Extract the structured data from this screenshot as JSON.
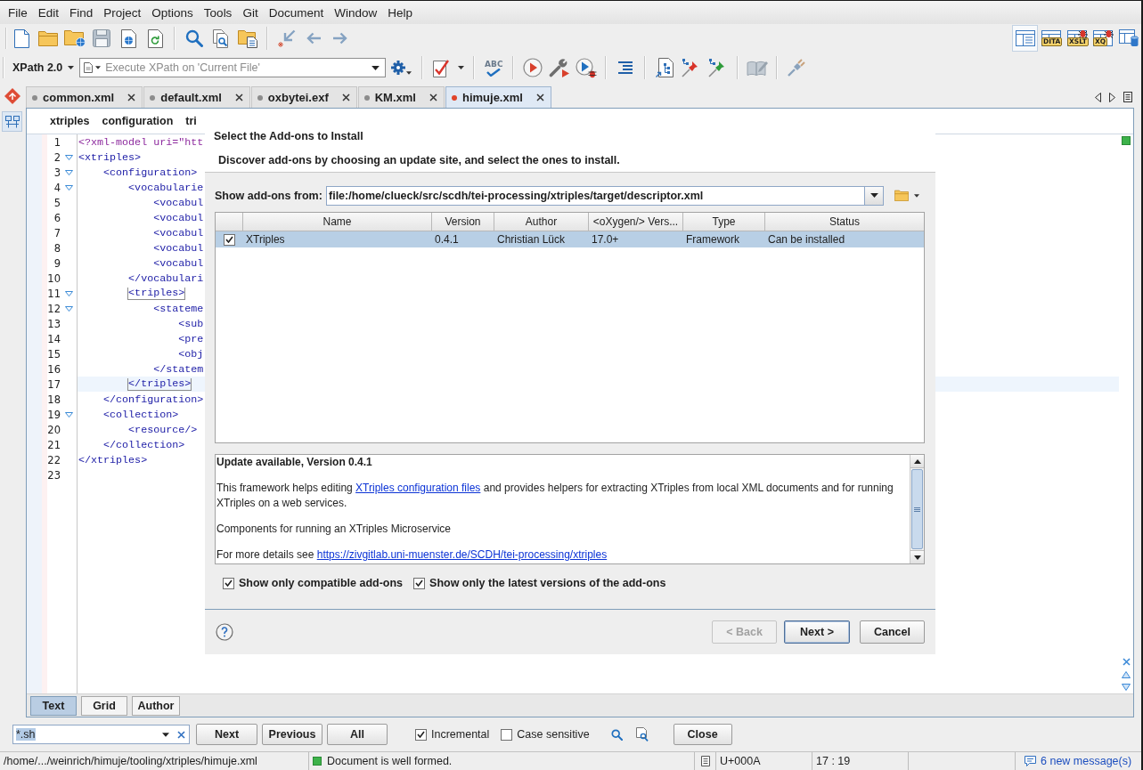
{
  "menu": [
    "File",
    "Edit",
    "Find",
    "Project",
    "Options",
    "Tools",
    "Git",
    "Document",
    "Window",
    "Help"
  ],
  "perspectives": [
    {
      "kind": "editor",
      "selected": true
    },
    {
      "kind": "dita",
      "label": "DITA",
      "selected": false
    },
    {
      "kind": "xslt",
      "label": "XSLT",
      "selected": false
    },
    {
      "kind": "xquery",
      "label": "XQ",
      "selected": false
    },
    {
      "kind": "database",
      "selected": false
    }
  ],
  "toolbar": {
    "xpath_version": "XPath 2.0",
    "xpath_placeholder": "Execute XPath on 'Current File'",
    "spellcheck_label": "ABC"
  },
  "side_views": [
    {
      "kind": "git",
      "selected": false
    },
    {
      "kind": "outline",
      "selected": true
    }
  ],
  "tabs": [
    {
      "label": "common.xml",
      "modified": false,
      "selected": false
    },
    {
      "label": "default.xml",
      "modified": false,
      "selected": false
    },
    {
      "label": "oxbytei.exf",
      "modified": false,
      "selected": false
    },
    {
      "label": "KM.xml",
      "modified": false,
      "selected": false
    },
    {
      "label": "himuje.xml",
      "modified": true,
      "selected": true
    }
  ],
  "breadcrumb": [
    "xtriples",
    "configuration",
    "tri"
  ],
  "editor": {
    "lines": [
      {
        "number": "1",
        "text": "<?xml-model uri=\"htt",
        "kind": "instruction",
        "foldable": false,
        "current": false,
        "matched": false
      },
      {
        "number": "2",
        "text": "<xtriples>",
        "kind": "markup",
        "foldable": true,
        "current": false,
        "matched": false
      },
      {
        "number": "3",
        "text": "    <configuration>",
        "kind": "markup",
        "foldable": true,
        "current": false,
        "matched": false
      },
      {
        "number": "4",
        "text": "        <vocabularie",
        "kind": "markup",
        "foldable": true,
        "current": false,
        "matched": false
      },
      {
        "number": "5",
        "text": "            <vocabul",
        "kind": "markup",
        "foldable": false,
        "current": false,
        "matched": false
      },
      {
        "number": "6",
        "text": "            <vocabul",
        "kind": "markup",
        "foldable": false,
        "current": false,
        "matched": false
      },
      {
        "number": "7",
        "text": "            <vocabul",
        "kind": "markup",
        "foldable": false,
        "current": false,
        "matched": false
      },
      {
        "number": "8",
        "text": "            <vocabul",
        "kind": "markup",
        "foldable": false,
        "current": false,
        "matched": false
      },
      {
        "number": "9",
        "text": "            <vocabul",
        "kind": "markup",
        "foldable": false,
        "current": false,
        "matched": false
      },
      {
        "number": "10",
        "text": "        </vocabulari",
        "kind": "markup",
        "foldable": false,
        "current": false,
        "matched": false
      },
      {
        "number": "11",
        "text": "        <triples>",
        "kind": "markup",
        "foldable": true,
        "current": false,
        "matched": true
      },
      {
        "number": "12",
        "text": "            <stateme",
        "kind": "markup",
        "foldable": true,
        "current": false,
        "matched": false
      },
      {
        "number": "13",
        "text": "                <sub",
        "kind": "markup",
        "foldable": false,
        "current": false,
        "matched": false
      },
      {
        "number": "14",
        "text": "                <pre",
        "kind": "markup",
        "foldable": false,
        "current": false,
        "matched": false
      },
      {
        "number": "15",
        "text": "                <obj",
        "kind": "markup",
        "foldable": false,
        "current": false,
        "matched": false
      },
      {
        "number": "16",
        "text": "            </statem",
        "kind": "markup",
        "foldable": false,
        "current": false,
        "matched": false
      },
      {
        "number": "17",
        "text": "        </triples>",
        "kind": "markup",
        "foldable": false,
        "current": true,
        "matched": true
      },
      {
        "number": "18",
        "text": "    </configuration>",
        "kind": "markup",
        "foldable": false,
        "current": false,
        "matched": false
      },
      {
        "number": "19",
        "text": "    <collection>",
        "kind": "markup",
        "foldable": true,
        "current": false,
        "matched": false
      },
      {
        "number": "20",
        "text": "        <resource/>",
        "kind": "markup",
        "foldable": false,
        "current": false,
        "matched": false
      },
      {
        "number": "21",
        "text": "    </collection>",
        "kind": "markup",
        "foldable": false,
        "current": false,
        "matched": false
      },
      {
        "number": "22",
        "text": "</xtriples>",
        "kind": "markup",
        "foldable": false,
        "current": false,
        "matched": false
      },
      {
        "number": "23",
        "foldable": false,
        "current": false
      }
    ]
  },
  "editor_modes": [
    {
      "label": "Text",
      "selected": true
    },
    {
      "label": "Grid",
      "selected": false
    },
    {
      "label": "Author",
      "selected": false
    }
  ],
  "find_bar": {
    "value": "*.sh",
    "value_selected": true,
    "buttons": [
      "Next",
      "Previous",
      "All"
    ],
    "options": [
      {
        "label": "Incremental",
        "checked": true
      },
      {
        "label": "Case sensitive",
        "checked": false
      }
    ],
    "close": "Close"
  },
  "status_bar": {
    "path": "/home/.../weinrich/himuje/tooling/xtriples/himuje.xml",
    "well_formed": true,
    "message": "Document is well formed.",
    "character": "U+000A",
    "position": "17 : 19",
    "messages": "6 new message(s)"
  },
  "dialog": {
    "title": "Select the Add-ons to Install",
    "subtitle": "Discover add-ons by choosing an update site, and select the ones to install.",
    "source_label": "Show add-ons from:",
    "source": "file:/home/clueck/src/scdh/tei-processing/xtriples/target/descriptor.xml",
    "table": {
      "columns": [
        "Name",
        "Version",
        "Author",
        "<oXygen/> Vers...",
        "Type",
        "Status"
      ],
      "rows": [
        {
          "checked": true,
          "selected": true,
          "cells": [
            "XTriples",
            "0.4.1",
            "Christian Lück",
            "17.0+",
            "Framework",
            "Can be installed"
          ]
        }
      ]
    },
    "description": {
      "heading": "Update available, Version 0.4.1",
      "paragraphs": [
        [
          {
            "kind": "text",
            "text": "This framework helps editing "
          },
          {
            "kind": "link",
            "text": "XTriples configuration files"
          },
          {
            "kind": "text",
            "text": " and provides helpers for extracting XTriples from local XML documents and for running XTriples on a web services."
          }
        ],
        [
          {
            "kind": "text",
            "text": "Components for running an XTriples Microservice"
          }
        ],
        [
          {
            "kind": "text",
            "text": "For more details see "
          },
          {
            "kind": "link",
            "text": "https://zivgitlab.uni-muenster.de/SCDH/tei-processing/xtriples"
          }
        ]
      ]
    },
    "options": [
      {
        "label": "Show only compatible add-ons",
        "checked": true
      },
      {
        "label": "Show only the latest versions of the add-ons",
        "checked": true
      }
    ],
    "buttons": [
      {
        "label": "< Back",
        "disabled": true,
        "default": false
      },
      {
        "label": "Next >",
        "disabled": false,
        "default": true
      },
      {
        "label": "Cancel",
        "disabled": false,
        "default": false
      }
    ]
  }
}
